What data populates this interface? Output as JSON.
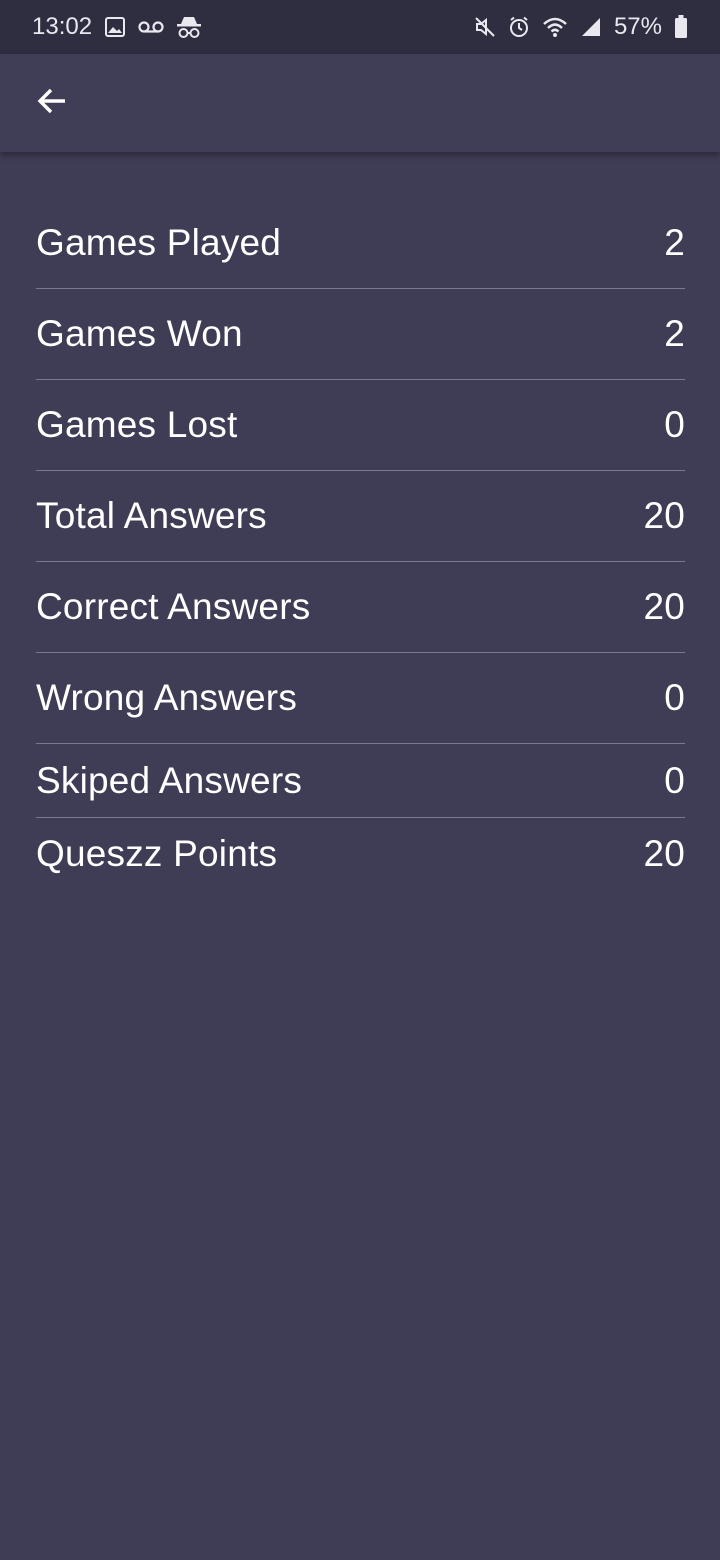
{
  "status_bar": {
    "time": "13:02",
    "battery": "57%",
    "left_icons": [
      "gallery-icon",
      "voicemail-icon",
      "incognito-icon"
    ],
    "right_icons": [
      "mute-icon",
      "alarm-icon",
      "wifi-icon",
      "signal-icon",
      "battery-icon"
    ]
  },
  "app_bar": {
    "back_icon": "arrow-back-icon"
  },
  "stats": [
    {
      "label": "Games Played",
      "value": "2"
    },
    {
      "label": "Games Won",
      "value": "2"
    },
    {
      "label": "Games Lost",
      "value": "0"
    },
    {
      "label": "Total Answers",
      "value": "20"
    },
    {
      "label": "Correct Answers",
      "value": "20"
    },
    {
      "label": "Wrong Answers",
      "value": "0"
    },
    {
      "label": "Skiped Answers",
      "value": "0"
    },
    {
      "label": "Queszz Points",
      "value": "20"
    }
  ],
  "colors": {
    "background": "#3f3c55",
    "status_bar": "#2f2d40",
    "divider": "#7a7890",
    "text": "#ffffff"
  }
}
